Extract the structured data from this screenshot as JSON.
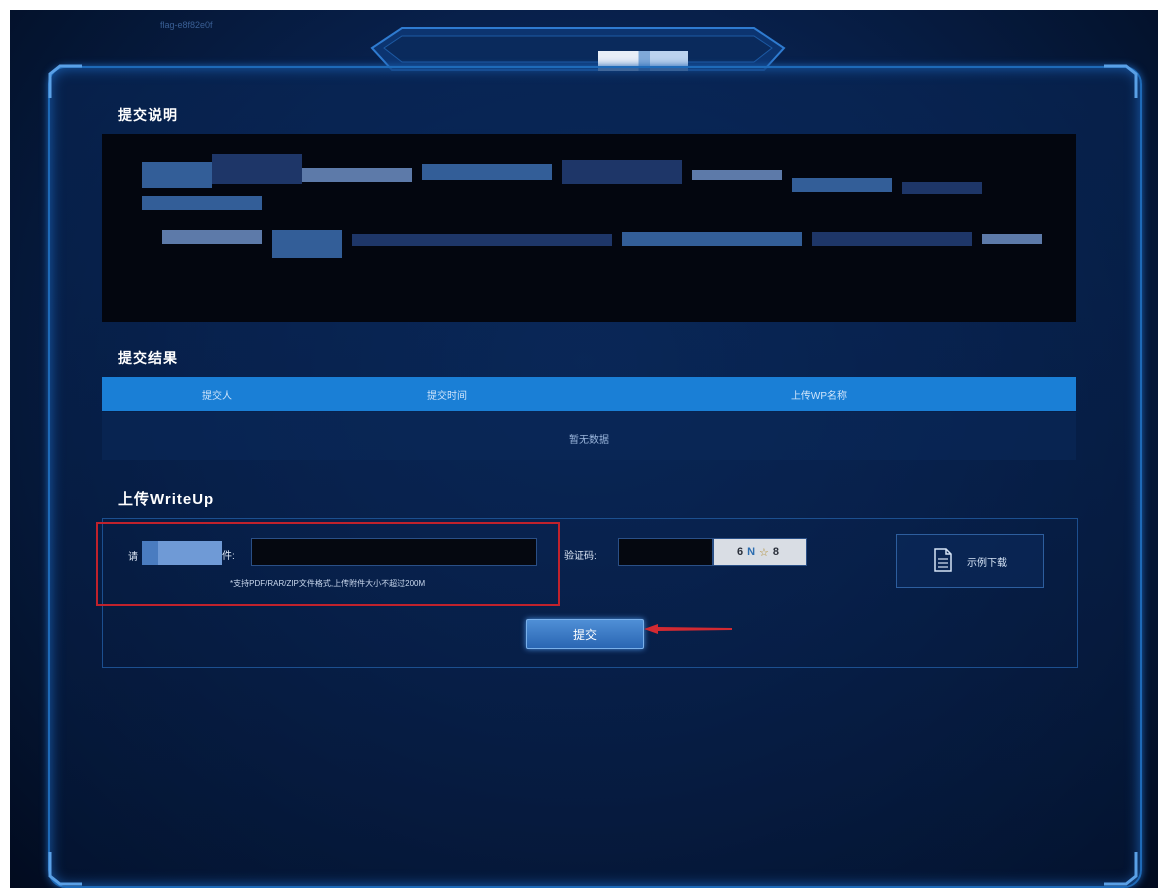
{
  "header": {
    "top_left_text": "flag-e8f82e0f"
  },
  "sections": {
    "description_title": "提交说明",
    "results_title": "提交结果",
    "upload_title": "上传WriteUp"
  },
  "results_table": {
    "columns": [
      "提交人",
      "提交时间",
      "上传WP名称"
    ],
    "empty_text": "暂无数据"
  },
  "upload_form": {
    "file_label_prefix": "请",
    "file_label_suffix": "件:",
    "file_hint": "*支持PDF/RAR/ZIP文件格式,上传附件大小不超过200M",
    "captcha_label": "验证码:",
    "captcha_text": {
      "c1": "6",
      "c2": "N",
      "c3": "☆",
      "c4": "8"
    },
    "sample_download_label": "示例下载",
    "submit_label": "提交"
  },
  "colors": {
    "accent": "#1a7fd6",
    "highlight_frame": "#c0222c",
    "panel_border": "#1e6ab8"
  }
}
